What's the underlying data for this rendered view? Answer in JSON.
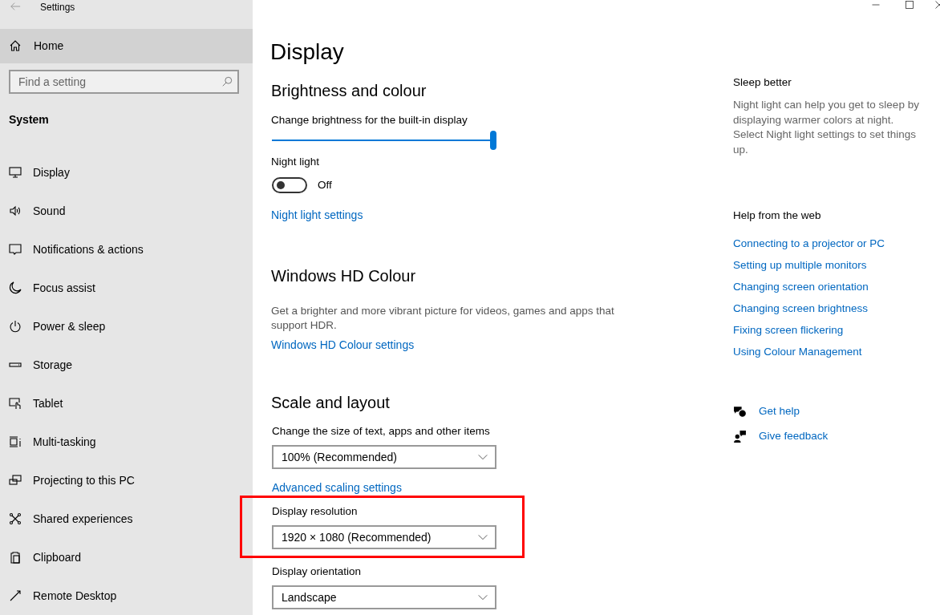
{
  "window": {
    "title": "Settings"
  },
  "sidebar": {
    "home": {
      "label": "Home",
      "hovered": true
    },
    "search": {
      "placeholder": "Find a setting"
    },
    "section": "System",
    "items": [
      {
        "label": "Display"
      },
      {
        "label": "Sound"
      },
      {
        "label": "Notifications & actions"
      },
      {
        "label": "Focus assist"
      },
      {
        "label": "Power & sleep"
      },
      {
        "label": "Storage"
      },
      {
        "label": "Tablet"
      },
      {
        "label": "Multi-tasking"
      },
      {
        "label": "Projecting to this PC"
      },
      {
        "label": "Shared experiences"
      },
      {
        "label": "Clipboard"
      },
      {
        "label": "Remote Desktop"
      }
    ]
  },
  "page": {
    "title": "Display",
    "brightness": {
      "heading": "Brightness and colour",
      "slider_label": "Change brightness for the built-in display",
      "level": 1,
      "night_light_label": "Night light",
      "night_light_on": false,
      "night_light_state": "Off",
      "link": "Night light settings"
    },
    "hdr": {
      "heading": "Windows HD Colour",
      "description": "Get a brighter and more vibrant picture for videos, games and apps that support HDR.",
      "link": "Windows HD Colour settings"
    },
    "scale": {
      "heading": "Scale and layout",
      "settings": [
        {
          "label": "Change the size of text, apps and other items",
          "value": "100% (Recommended)",
          "highlighted": false,
          "link": "Advanced scaling settings"
        },
        {
          "label": "Display resolution",
          "value": "1920 × 1080 (Recommended)",
          "highlighted": true
        },
        {
          "label": "Display orientation",
          "value": "Landscape",
          "highlighted": false
        }
      ]
    }
  },
  "related": {
    "sleep": {
      "heading": "Sleep better",
      "text": "Night light can help you get to sleep by displaying warmer colors at night. Select Night light settings to set things up."
    },
    "help": {
      "heading": "Help from the web",
      "links": [
        "Connecting to a projector or PC",
        "Setting up multiple monitors",
        "Changing screen orientation",
        "Changing screen brightness",
        "Fixing screen flickering",
        "Using Colour Management"
      ]
    },
    "actions": [
      "Get help",
      "Give feedback"
    ]
  }
}
